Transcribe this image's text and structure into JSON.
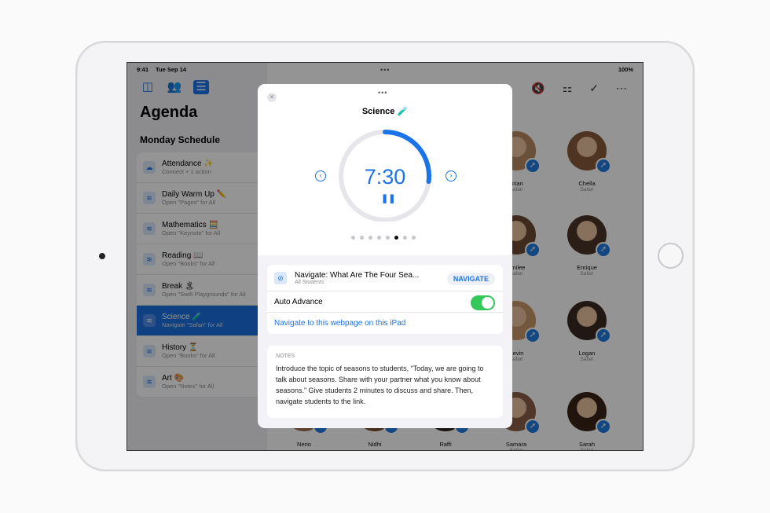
{
  "status": {
    "time": "9:41",
    "date": "Tue Sep 14",
    "battery": "100%"
  },
  "sidebar": {
    "title": "Agenda",
    "section": "Monday Schedule",
    "items": [
      {
        "title": "Attendance ✨",
        "subtitle": "Connect + 1 action",
        "icon": "attendance-icon"
      },
      {
        "title": "Daily Warm Up ✏️",
        "subtitle": "Open \"Pages\" for All",
        "icon": "stack-icon"
      },
      {
        "title": "Mathematics 🧮",
        "subtitle": "Open \"Keynote\" for All",
        "icon": "stack-icon"
      },
      {
        "title": "Reading 📖",
        "subtitle": "Open \"Books\" for All",
        "icon": "stack-icon"
      },
      {
        "title": "Break 🏝",
        "subtitle": "Open \"Swift Playgrounds\" for All",
        "icon": "stack-icon"
      },
      {
        "title": "Science 🧪",
        "subtitle": "Navigate \"Safari\" for All",
        "icon": "stack-icon",
        "selected": true
      },
      {
        "title": "History ⏳",
        "subtitle": "Open \"Books\" for All",
        "icon": "stack-icon"
      },
      {
        "title": "Art 🎨",
        "subtitle": "Open \"Notes\" for All",
        "icon": "stack-icon"
      }
    ]
  },
  "students": [
    {
      "name": "Brian",
      "app": "Safari"
    },
    {
      "name": "Chella",
      "app": "Safari"
    },
    {
      "name": "Emilee",
      "app": "Safari"
    },
    {
      "name": "Enrique",
      "app": "Safari"
    },
    {
      "name": "Kevin",
      "app": "Safari"
    },
    {
      "name": "Logan",
      "app": "Safari"
    },
    {
      "name": "Nerio",
      "app": ""
    },
    {
      "name": "Nidhi",
      "app": ""
    },
    {
      "name": "Raffi",
      "app": ""
    },
    {
      "name": "Samara",
      "app": "Safari"
    },
    {
      "name": "Sarah",
      "app": "Safari"
    }
  ],
  "modal": {
    "title": "Science 🧪",
    "timer": "7:30",
    "timer_progress": 0.27,
    "page_count": 8,
    "page_active": 6,
    "action_title": "Navigate: What Are The Four Sea...",
    "action_subtitle": "All Students",
    "navigate_label": "NAVIGATE",
    "auto_advance_label": "Auto Advance",
    "auto_advance": true,
    "link": "Navigate to this webpage on this iPad",
    "notes_header": "NOTES",
    "notes": "Introduce the topic of seasons to students, “Today, we are going to talk about seasons. Share with your partner what you know about seasons.” Give students 2 minutes to discuss and share. Then, navigate students to the link."
  },
  "colors": {
    "accent": "#1a73e8",
    "toggle": "#34c759"
  }
}
